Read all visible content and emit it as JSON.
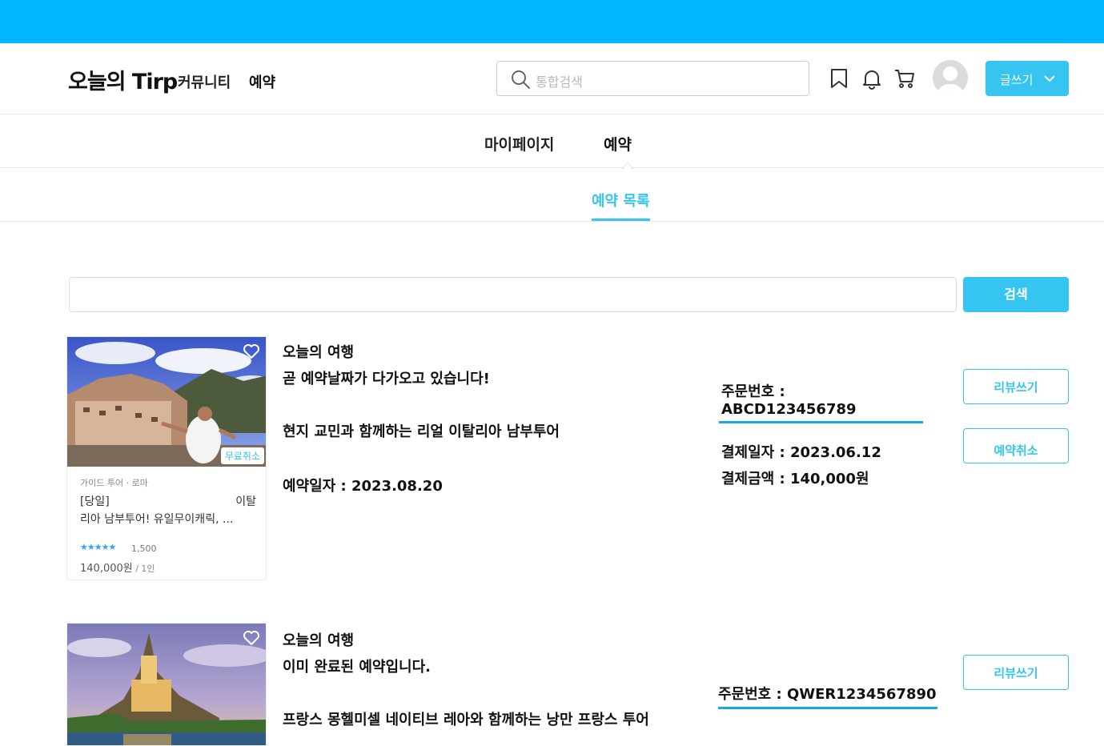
{
  "header": {
    "logo": "오늘의 Tirp",
    "nav": [
      "커뮤니티",
      "예약"
    ],
    "search_placeholder": "통합검색",
    "write_button": "글쓰기"
  },
  "subnav": {
    "items": [
      "마이페이지",
      "예약"
    ],
    "active": "예약"
  },
  "tab": {
    "label": "예약 목록"
  },
  "list_search": {
    "value": "",
    "button": "검색"
  },
  "bookings": [
    {
      "brand": "오늘의 여행",
      "status": "곧 예약날짜가 다가오고 있습니다!",
      "tour_title": "현지 교민과 함께하는 리얼 이탈리아 남부투어",
      "reserve_date": "예약일자 : 2023.08.20",
      "order_no": "주문번호 : ABCD123456789",
      "pay_date": "결제일자 : 2023.06.12",
      "pay_amount": "결제금액 : 140,000원",
      "buttons": [
        "리뷰쓰기",
        "예약취소"
      ],
      "card": {
        "badge": "무료취소",
        "meta": "가이드 투어 · 로마",
        "title_line1_left": "[당일]",
        "title_line1_right": "이탈",
        "title_line2": "리아 남부투어! 유일무이캐릭, ...",
        "stars": "★★★★★",
        "rating_count": "1,500",
        "price": "140,000원",
        "per": " / 1인"
      }
    },
    {
      "brand": "오늘의 여행",
      "status": "이미 완료된 예약입니다.",
      "tour_title": "프랑스 몽헬미셀 네이티브 레아와 함께하는 낭만 프랑스 투어",
      "order_no": "주문번호 : QWER1234567890",
      "buttons": [
        "리뷰쓰기"
      ]
    }
  ],
  "colors": {
    "topbar": "#00b7ff",
    "accent": "#35c5f0"
  }
}
